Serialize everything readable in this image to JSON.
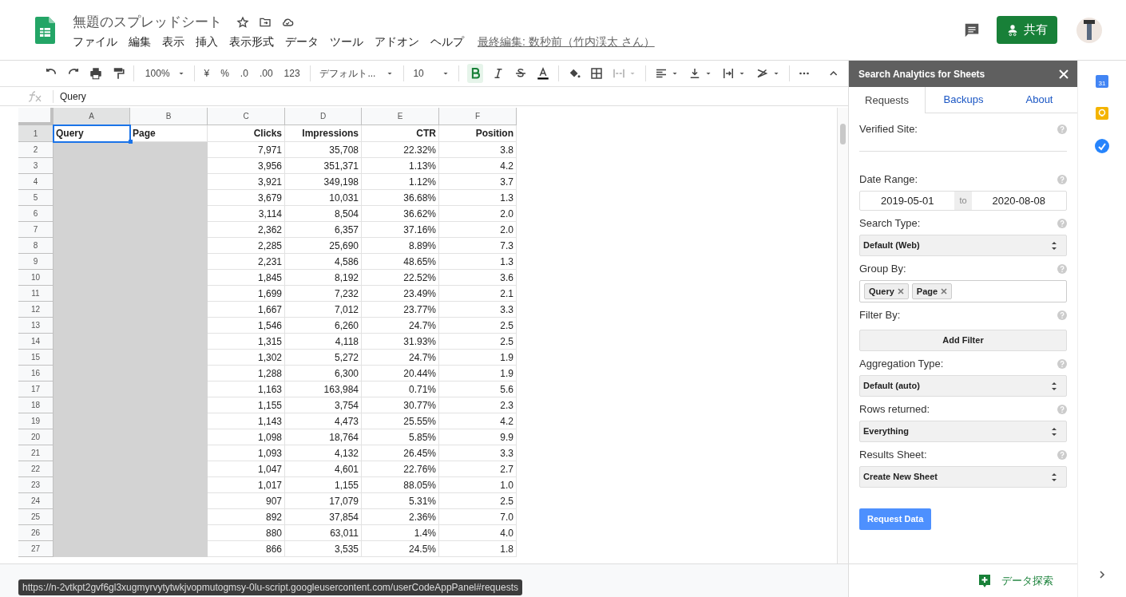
{
  "document": {
    "title": "無題のスプレッドシート",
    "last_edit": "最終編集: 数秒前（竹内渓太 さん）"
  },
  "menu": [
    "ファイル",
    "編集",
    "表示",
    "挿入",
    "表示形式",
    "データ",
    "ツール",
    "アドオン",
    "ヘルプ"
  ],
  "share_button": "共有",
  "toolbar": {
    "zoom": "100%",
    "currency": "¥",
    "percent": "%",
    "decimal_decrease": ".0",
    "decimal_increase": ".00",
    "number_format": "123",
    "font": "デフォルト...",
    "font_size": "10",
    "bold": true
  },
  "formula_bar": {
    "value": "Query"
  },
  "grid": {
    "columns": [
      {
        "letter": "A",
        "selected": true
      },
      {
        "letter": "B",
        "selected": false
      },
      {
        "letter": "C",
        "selected": false
      },
      {
        "letter": "D",
        "selected": false
      },
      {
        "letter": "E",
        "selected": false
      },
      {
        "letter": "F",
        "selected": false
      }
    ],
    "header_row": {
      "number": "1",
      "selected": true,
      "cells": [
        "Query",
        "Page",
        "Clicks",
        "Impressions",
        "CTR",
        "Position"
      ]
    },
    "rows": [
      {
        "number": "2",
        "cells": [
          "7,971",
          "35,708",
          "22.32%",
          "3.8"
        ]
      },
      {
        "number": "3",
        "cells": [
          "3,956",
          "351,371",
          "1.13%",
          "4.2"
        ]
      },
      {
        "number": "4",
        "cells": [
          "3,921",
          "349,198",
          "1.12%",
          "3.7"
        ]
      },
      {
        "number": "5",
        "cells": [
          "3,679",
          "10,031",
          "36.68%",
          "1.3"
        ]
      },
      {
        "number": "6",
        "cells": [
          "3,114",
          "8,504",
          "36.62%",
          "2.0"
        ]
      },
      {
        "number": "7",
        "cells": [
          "2,362",
          "6,357",
          "37.16%",
          "2.0"
        ]
      },
      {
        "number": "8",
        "cells": [
          "2,285",
          "25,690",
          "8.89%",
          "7.3"
        ]
      },
      {
        "number": "9",
        "cells": [
          "2,231",
          "4,586",
          "48.65%",
          "1.3"
        ]
      },
      {
        "number": "10",
        "cells": [
          "1,845",
          "8,192",
          "22.52%",
          "3.6"
        ]
      },
      {
        "number": "11",
        "cells": [
          "1,699",
          "7,232",
          "23.49%",
          "2.1"
        ]
      },
      {
        "number": "12",
        "cells": [
          "1,667",
          "7,012",
          "23.77%",
          "3.3"
        ]
      },
      {
        "number": "13",
        "cells": [
          "1,546",
          "6,260",
          "24.7%",
          "2.5"
        ]
      },
      {
        "number": "14",
        "cells": [
          "1,315",
          "4,118",
          "31.93%",
          "2.5"
        ]
      },
      {
        "number": "15",
        "cells": [
          "1,302",
          "5,272",
          "24.7%",
          "1.9"
        ]
      },
      {
        "number": "16",
        "cells": [
          "1,288",
          "6,300",
          "20.44%",
          "1.9"
        ]
      },
      {
        "number": "17",
        "cells": [
          "1,163",
          "163,984",
          "0.71%",
          "5.6"
        ]
      },
      {
        "number": "18",
        "cells": [
          "1,155",
          "3,754",
          "30.77%",
          "2.3"
        ]
      },
      {
        "number": "19",
        "cells": [
          "1,143",
          "4,473",
          "25.55%",
          "4.2"
        ]
      },
      {
        "number": "20",
        "cells": [
          "1,098",
          "18,764",
          "5.85%",
          "9.9"
        ]
      },
      {
        "number": "21",
        "cells": [
          "1,093",
          "4,132",
          "26.45%",
          "3.3"
        ]
      },
      {
        "number": "22",
        "cells": [
          "1,047",
          "4,601",
          "22.76%",
          "2.7"
        ]
      },
      {
        "number": "23",
        "cells": [
          "1,017",
          "1,155",
          "88.05%",
          "1.0"
        ]
      },
      {
        "number": "24",
        "cells": [
          "907",
          "17,079",
          "5.31%",
          "2.5"
        ]
      },
      {
        "number": "25",
        "cells": [
          "892",
          "37,854",
          "2.36%",
          "7.0"
        ]
      },
      {
        "number": "26",
        "cells": [
          "880",
          "63,011",
          "1.4%",
          "4.0"
        ]
      },
      {
        "number": "27",
        "cells": [
          "866",
          "3,535",
          "24.5%",
          "1.8"
        ]
      }
    ]
  },
  "sidebar": {
    "title": "Search Analytics for Sheets",
    "tabs": [
      {
        "label": "Requests",
        "selected": true
      },
      {
        "label": "Backups",
        "selected": false
      },
      {
        "label": "About",
        "selected": false
      }
    ],
    "fields": [
      {
        "kind": "text",
        "label": "Verified Site:"
      },
      {
        "kind": "daterange",
        "label": "Date Range:",
        "from": "2019-05-01",
        "separator": "to",
        "to": "2020-08-08"
      },
      {
        "kind": "select",
        "label": "Search Type:",
        "value": "Default (Web)"
      },
      {
        "kind": "tags",
        "label": "Group By:",
        "tags": [
          "Query",
          "Page"
        ]
      },
      {
        "kind": "button",
        "label": "Filter By:",
        "button": "Add Filter"
      },
      {
        "kind": "select",
        "label": "Aggregation Type:",
        "value": "Default (auto)"
      },
      {
        "kind": "select",
        "label": "Rows returned:",
        "value": "Everything"
      },
      {
        "kind": "select",
        "label": "Results Sheet:",
        "value": "Create New Sheet"
      }
    ],
    "submit": "Request Data"
  },
  "side_rail": {
    "calendar_day": "31"
  },
  "explore_button": "データ探索",
  "status_url": "https://n-2vtkpt2gvf6gl3xugmyrvytytwkjvopmutogmsy-0lu-script.googleusercontent.com/userCodeAppPanel#requests"
}
